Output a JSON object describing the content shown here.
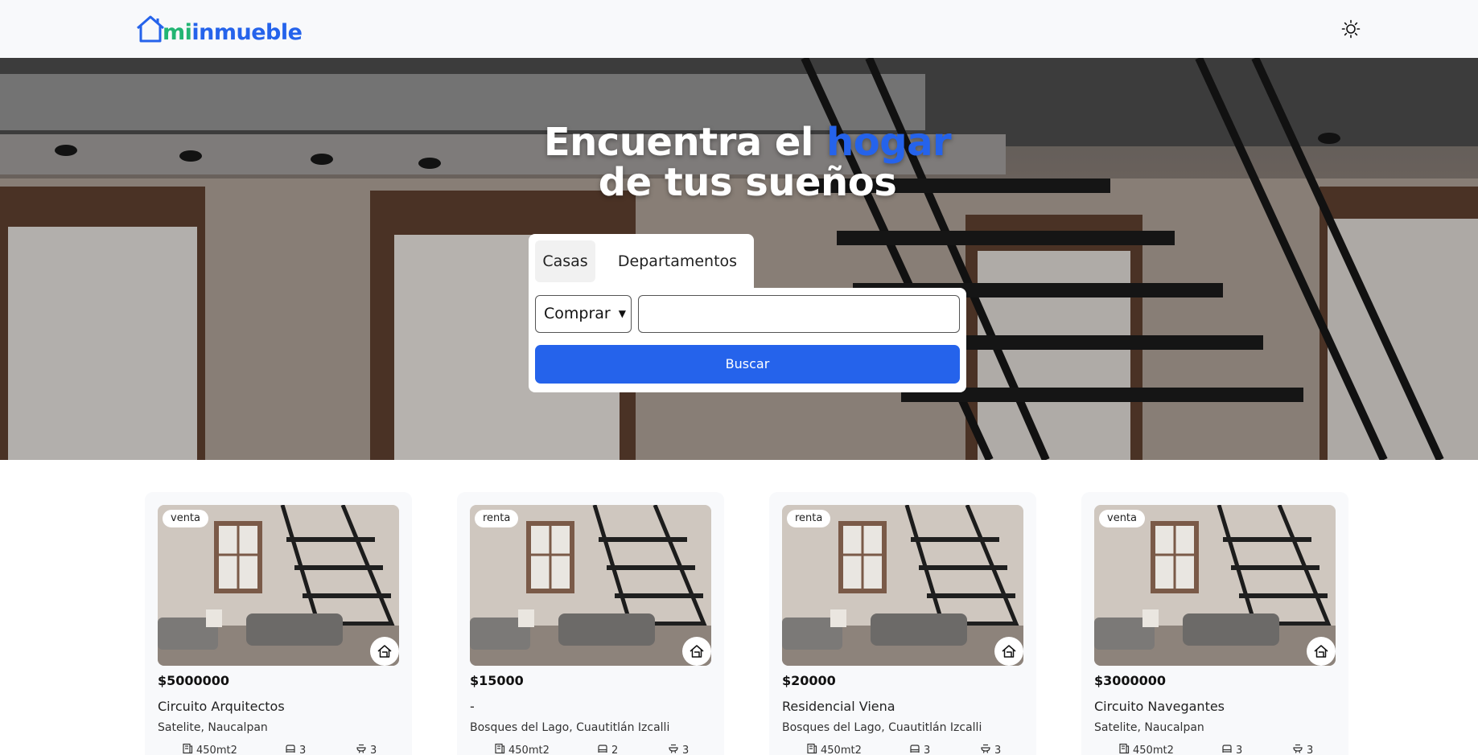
{
  "header": {
    "logo_part1": "mi",
    "logo_part2": "inmueble",
    "theme_icon": "sun-icon"
  },
  "hero": {
    "title_part1": "Encuentra el ",
    "title_highlight": "hogar",
    "title_line2": "de tus sueños",
    "highlight_color": "#2563eb"
  },
  "search": {
    "tabs": [
      {
        "label": "Casas"
      },
      {
        "label": "Departamentos"
      }
    ],
    "operation_selected": "Comprar",
    "query_value": "",
    "button_label": "Buscar",
    "button_color": "#2563eb"
  },
  "listings": [
    {
      "badge": "venta",
      "price": "$5000000",
      "name": "Circuito Arquitectos",
      "location": "Satelite, Naucalpan",
      "area": "450mt2",
      "bedrooms": "3",
      "bathrooms": "3"
    },
    {
      "badge": "renta",
      "price": "$15000",
      "name": "-",
      "location": "Bosques del Lago, Cuautitlán Izcalli",
      "area": "450mt2",
      "bedrooms": "2",
      "bathrooms": "3"
    },
    {
      "badge": "renta",
      "price": "$20000",
      "name": "Residencial Viena",
      "location": "Bosques del Lago, Cuautitlán Izcalli",
      "area": "450mt2",
      "bedrooms": "3",
      "bathrooms": "3"
    },
    {
      "badge": "venta",
      "price": "$3000000",
      "name": "Circuito Navegantes",
      "location": "Satelite, Naucalpan",
      "area": "450mt2",
      "bedrooms": "3",
      "bathrooms": "3"
    }
  ]
}
